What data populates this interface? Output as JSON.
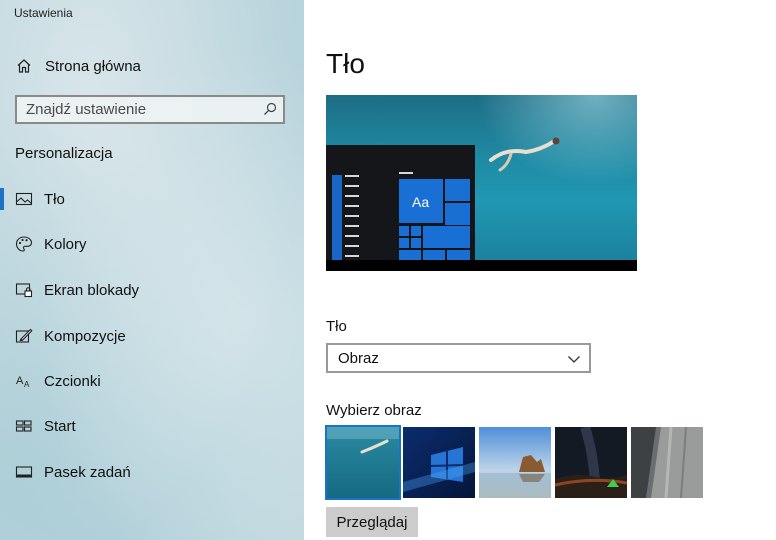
{
  "window": {
    "title": "Ustawienia"
  },
  "sidebar": {
    "home_label": "Strona główna",
    "search_placeholder": "Znajdź ustawienie",
    "section_title": "Personalizacja",
    "items": [
      {
        "label": "Tło",
        "icon": "picture-icon",
        "active": true
      },
      {
        "label": "Kolory",
        "icon": "palette-icon"
      },
      {
        "label": "Ekran blokady",
        "icon": "lock-screen-icon"
      },
      {
        "label": "Kompozycje",
        "icon": "theme-brush-icon"
      },
      {
        "label": "Czcionki",
        "icon": "font-icon"
      },
      {
        "label": "Start",
        "icon": "start-menu-icon"
      },
      {
        "label": "Pasek zadań",
        "icon": "taskbar-icon"
      }
    ]
  },
  "main": {
    "title": "Tło",
    "preview": {
      "sample_text": "Aa"
    },
    "background_label": "Tło",
    "background_value": "Obraz",
    "choose_label": "Wybierz obraz",
    "thumbnails": [
      {
        "name": "underwater-swimmer",
        "selected": true
      },
      {
        "name": "windows-logo-blue"
      },
      {
        "name": "beach-rocks"
      },
      {
        "name": "night-sky-tent"
      },
      {
        "name": "rock-cliff"
      }
    ],
    "browse_label": "Przeglądaj"
  },
  "colors": {
    "accent": "#1a73c6",
    "tile_blue": "#1a6fd4"
  }
}
